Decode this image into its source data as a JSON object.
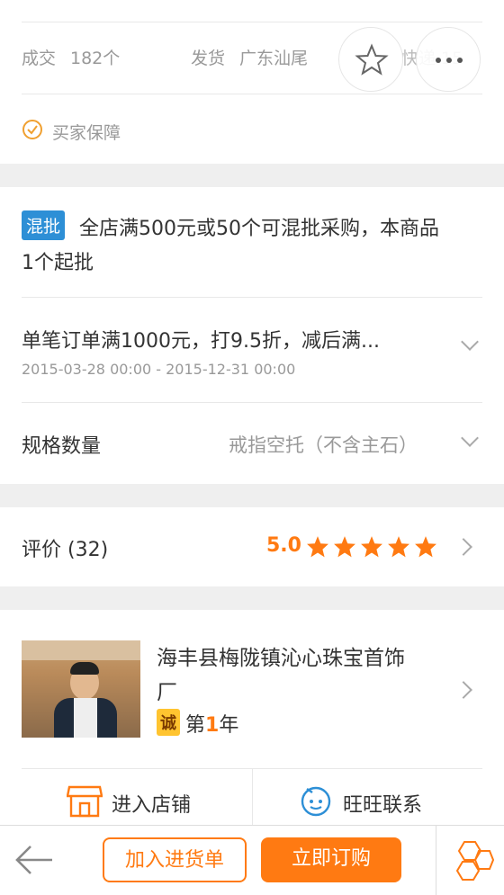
{
  "stats": {
    "deal_label": "成交",
    "deal_count": "182个",
    "ship_label": "发货",
    "ship_location": "广东汕尾",
    "express_partial": "快递 15"
  },
  "guarantee": {
    "label": "买家保障"
  },
  "promo": {
    "badge": "混批",
    "text_line1": "全店满500元或50个可混批采购，本商品",
    "text_line2": "1个起批",
    "discount_title": "单笔订单满1000元，打9.5折，减后满...",
    "discount_dates": "2015-03-28 00:00 - 2015-12-31 00:00"
  },
  "spec": {
    "label": "规格数量",
    "value": "戒指空托（不含主石）"
  },
  "review": {
    "label": "评价 (32)",
    "score": "5.0",
    "stars": 5
  },
  "shop": {
    "name_line1": "海丰县梅陇镇沁心珠宝首饰",
    "name_line2": "厂",
    "cheng_badge": "诚",
    "year_prefix": "第",
    "year_num": "1",
    "year_suffix": "年",
    "enter_label": "进入店铺",
    "wangwang_label": "旺旺联系"
  },
  "bottom": {
    "add_cart": "加入进货单",
    "order_now": "立即订购"
  },
  "colors": {
    "orange": "#ff7a12",
    "blue_badge": "#2d8fd6",
    "star": "#ff7a12"
  }
}
